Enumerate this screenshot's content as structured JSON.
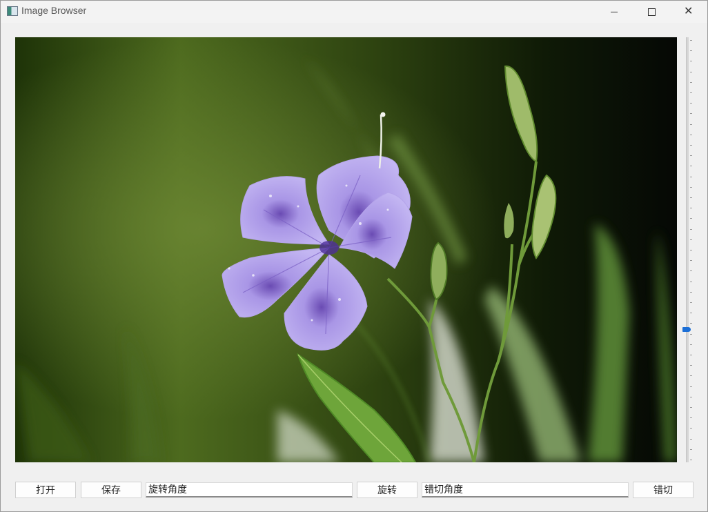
{
  "window": {
    "title": "Image Browser",
    "icon": "app-image-icon",
    "controls": {
      "minimize": "minimize-icon",
      "maximize": "maximize-icon",
      "close": "close-icon",
      "close_glyph": "✕"
    }
  },
  "image": {
    "subject": "purple flower photo"
  },
  "slider": {
    "value": 0.69,
    "orientation": "vertical"
  },
  "toolbar": {
    "open_label": "打开",
    "save_label": "保存",
    "rotate_angle_placeholder": "旋转角度",
    "rotate_label": "旋转",
    "shear_angle_placeholder": "错切角度",
    "shear_label": "错切"
  },
  "colors": {
    "accent": "#1c6fd6",
    "window_bg": "#f0f0f0"
  }
}
